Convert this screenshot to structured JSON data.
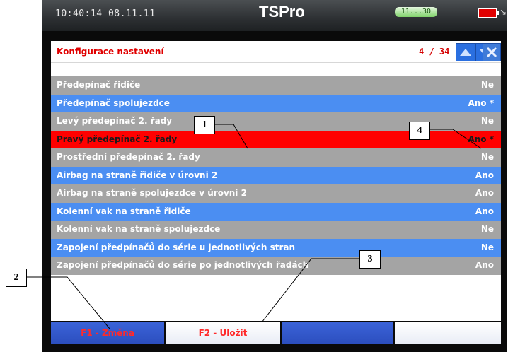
{
  "status_bar": {
    "datetime": "10:40:14 08.11.11",
    "app_title": "TSPro",
    "wifi_label": "11...30",
    "battery_color": "#e00000"
  },
  "window": {
    "title": "Konfigurace nastavení",
    "page_counter": "4 / 34",
    "nav_icons": [
      "arrow-up-icon",
      "arrow-down-icon",
      "close-icon"
    ]
  },
  "rows": [
    {
      "label": "Předepínač řidiče",
      "value": "Ne",
      "style": "gray"
    },
    {
      "label": "Předepínač spolujezdce",
      "value": "Ano *",
      "style": "blue"
    },
    {
      "label": "Levý předepínač 2. řady",
      "value": "Ne",
      "style": "gray"
    },
    {
      "label": "Pravý předepínač 2. řady",
      "value": "Ano *",
      "style": "sel"
    },
    {
      "label": "Prostřední předepínač 2. řady",
      "value": "Ne",
      "style": "gray"
    },
    {
      "label": "Airbag na straně řidiče v úrovni 2",
      "value": "Ano",
      "style": "blue"
    },
    {
      "label": "Airbag na straně spolujezdce v úrovni 2",
      "value": "Ano",
      "style": "gray"
    },
    {
      "label": "Kolenní vak na straně řidiče",
      "value": "Ano",
      "style": "blue"
    },
    {
      "label": "Kolenní vak na straně spolujezdce",
      "value": "Ne",
      "style": "gray"
    },
    {
      "label": "Zapojení předpínačů do série u jednotlivých stran",
      "value": "Ne",
      "style": "blue"
    },
    {
      "label": "Zapojení předpínačů do série po jednotlivých řadách",
      "value": "Ano",
      "style": "gray"
    }
  ],
  "function_keys": {
    "f1": "F1 - Změna",
    "f2": "F2 - Uložit",
    "f3": "",
    "f4": ""
  },
  "callouts": [
    "1",
    "2",
    "3",
    "4"
  ]
}
